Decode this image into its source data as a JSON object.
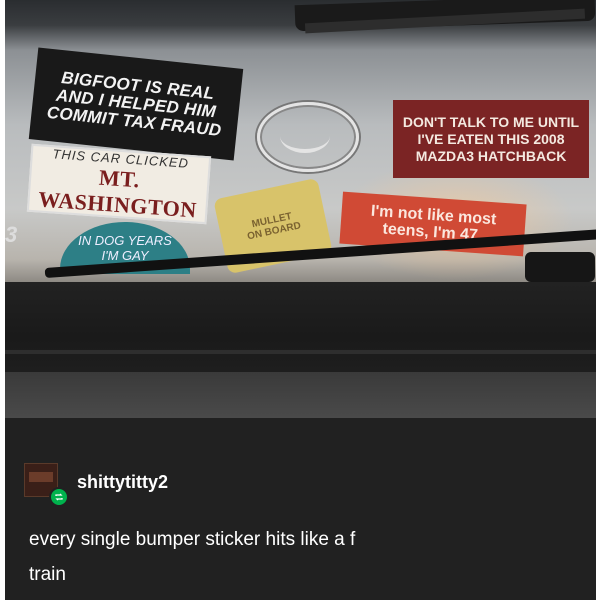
{
  "photo": {
    "stickers": {
      "bigfoot": "BIGFOOT IS REAL\nAND I HELPED HIM\nCOMMIT TAX FRAUD",
      "mt_small": "THIS CAR CLICKED",
      "mt_big": "MT. WASHINGTON",
      "dog_years": "IN DOG YEARS\nI'M GAY",
      "mullet": "MULLET\nON BOARD",
      "dont_talk": "DON'T TALK TO ME UNTIL\nI'VE EATEN THIS 2008\nMAZDA3 HATCHBACK",
      "teens": "I'm not like most\nteens, I'm 47."
    },
    "emblem": "3"
  },
  "post": {
    "username": "shittytitty2",
    "caption": "every single bumper sticker hits like a f\ntrain",
    "reblog_icon": "reblog-icon",
    "badge_color": "#00b24d"
  }
}
